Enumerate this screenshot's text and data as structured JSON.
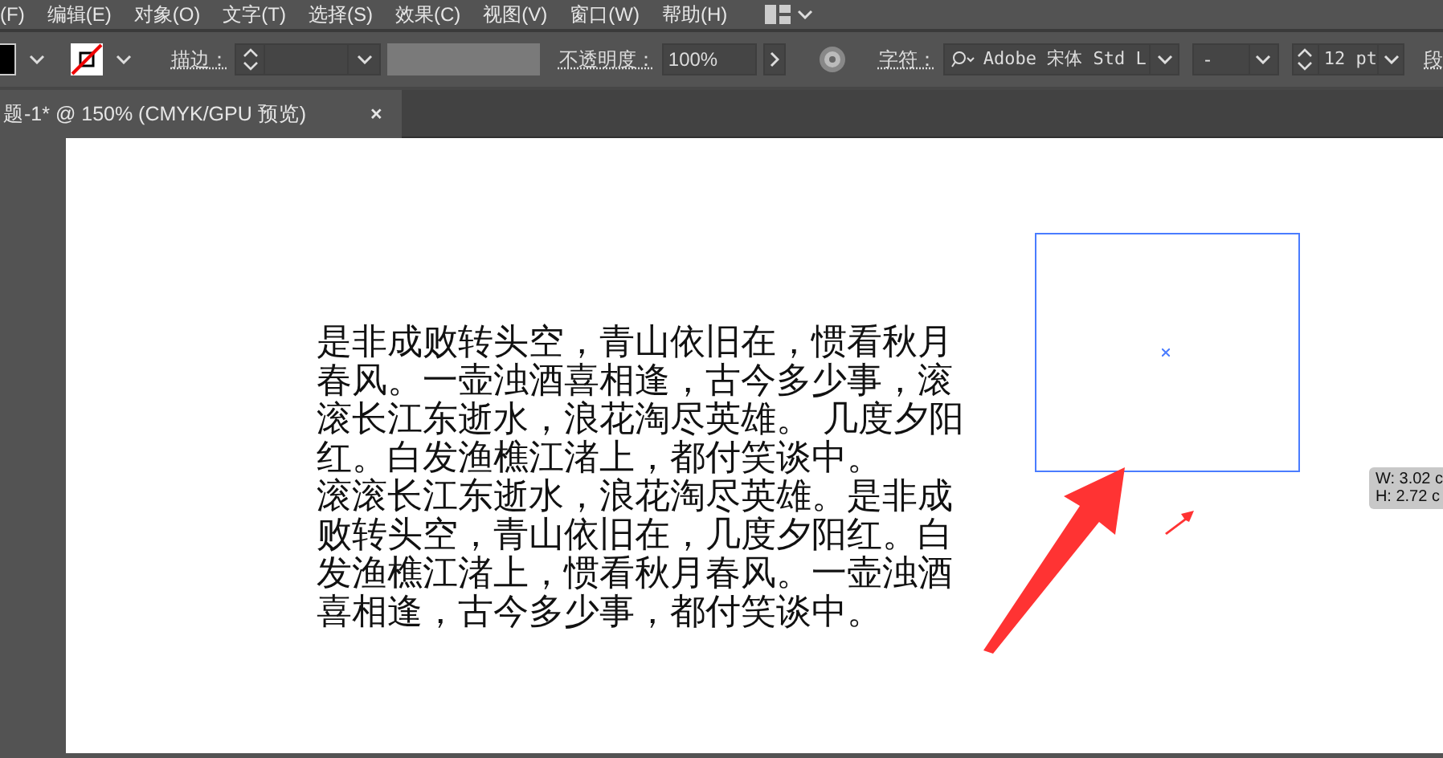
{
  "menu_bar": {
    "items": [
      "(F)",
      "编辑(E)",
      "对象(O)",
      "文字(T)",
      "选择(S)",
      "效果(C)",
      "视图(V)",
      "窗口(W)",
      "帮助(H)"
    ]
  },
  "control_bar": {
    "stroke_label": "描边：",
    "opacity_label": "不透明度：",
    "opacity_value": "100%",
    "character_label": "字符：",
    "font_family": "Adobe 宋体 Std L",
    "font_style": "-",
    "font_size": "12 pt",
    "paragraph_label": "段"
  },
  "document_tab": {
    "title": "题-1* @ 150% (CMYK/GPU 预览)",
    "close": "×"
  },
  "artboard": {
    "paragraphs": [
      "是非成败转头空，青山依旧在，惯看秋月春风。一壶浊酒喜相逢，古今多少事，滚滚长江东逝水，浪花淘尽英雄。 几度夕阳红。白发渔樵江渚上，都付笑谈中。",
      "滚滚长江东逝水，浪花淘尽英雄。是非成败转头空，青山依旧在，几度夕阳红。白发渔樵江渚上，惯看秋月春风。一壶浊酒喜相逢，古今多少事，都付笑谈中。"
    ],
    "selection_tooltip": [
      "W: 3.02 c",
      "H: 2.72 c"
    ]
  }
}
